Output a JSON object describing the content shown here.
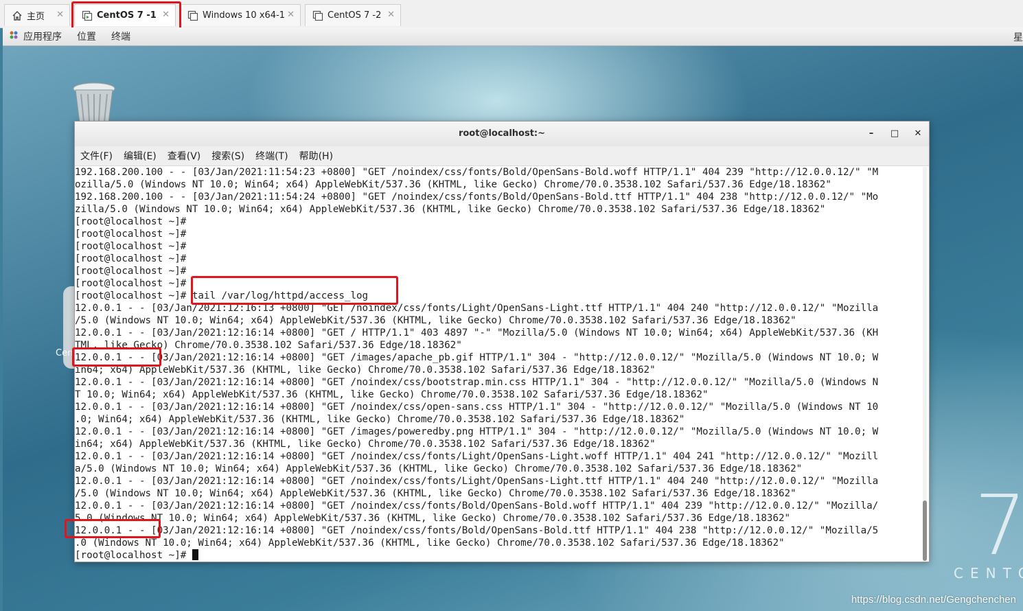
{
  "tabs": [
    {
      "label": "主页",
      "icon": "home-icon"
    },
    {
      "label": "CentOS 7 -1",
      "icon": "vm-icon",
      "active": true
    },
    {
      "label": "Windows 10 x64-1",
      "icon": "vm-icon"
    },
    {
      "label": "CentOS 7 -2",
      "icon": "vm-icon"
    }
  ],
  "tab_close_glyph": "✕",
  "gnome": {
    "apps": "应用程序",
    "places": "位置",
    "terminal": "终端",
    "right_glyph": "星"
  },
  "desktop": {
    "cen_label": "Cen",
    "centos_seven": "7",
    "centos_word": "CENTO",
    "watermark": "https://blog.csdn.net/Gengchenchen"
  },
  "terminal": {
    "title": "root@localhost:~",
    "min": "–",
    "max": "□",
    "close": "✕",
    "menu": [
      "文件(F)",
      "编辑(E)",
      "查看(V)",
      "搜索(S)",
      "终端(T)",
      "帮助(H)"
    ],
    "lines": [
      "192.168.200.100 - - [03/Jan/2021:11:54:23 +0800] \"GET /noindex/css/fonts/Bold/OpenSans-Bold.woff HTTP/1.1\" 404 239 \"http://12.0.0.12/\" \"M",
      "ozilla/5.0 (Windows NT 10.0; Win64; x64) AppleWebKit/537.36 (KHTML, like Gecko) Chrome/70.0.3538.102 Safari/537.36 Edge/18.18362\"",
      "192.168.200.100 - - [03/Jan/2021:11:54:24 +0800] \"GET /noindex/css/fonts/Bold/OpenSans-Bold.ttf HTTP/1.1\" 404 238 \"http://12.0.0.12/\" \"Mo",
      "zilla/5.0 (Windows NT 10.0; Win64; x64) AppleWebKit/537.36 (KHTML, like Gecko) Chrome/70.0.3538.102 Safari/537.36 Edge/18.18362\"",
      "[root@localhost ~]#",
      "[root@localhost ~]#",
      "[root@localhost ~]#",
      "[root@localhost ~]#",
      "[root@localhost ~]#",
      "[root@localhost ~]#",
      "[root@localhost ~]# tail /var/log/httpd/access_log",
      "12.0.0.1 - - [03/Jan/2021:12:16:13 +0800] \"GET /noindex/css/fonts/Light/OpenSans-Light.ttf HTTP/1.1\" 404 240 \"http://12.0.0.12/\" \"Mozilla",
      "/5.0 (Windows NT 10.0; Win64; x64) AppleWebKit/537.36 (KHTML, like Gecko) Chrome/70.0.3538.102 Safari/537.36 Edge/18.18362\"",
      "12.0.0.1 - - [03/Jan/2021:12:16:14 +0800] \"GET / HTTP/1.1\" 403 4897 \"-\" \"Mozilla/5.0 (Windows NT 10.0; Win64; x64) AppleWebKit/537.36 (KH",
      "TML, like Gecko) Chrome/70.0.3538.102 Safari/537.36 Edge/18.18362\"",
      "12.0.0.1 - - [03/Jan/2021:12:16:14 +0800] \"GET /images/apache_pb.gif HTTP/1.1\" 304 - \"http://12.0.0.12/\" \"Mozilla/5.0 (Windows NT 10.0; W",
      "in64; x64) AppleWebKit/537.36 (KHTML, like Gecko) Chrome/70.0.3538.102 Safari/537.36 Edge/18.18362\"",
      "12.0.0.1 - - [03/Jan/2021:12:16:14 +0800] \"GET /noindex/css/bootstrap.min.css HTTP/1.1\" 304 - \"http://12.0.0.12/\" \"Mozilla/5.0 (Windows N",
      "T 10.0; Win64; x64) AppleWebKit/537.36 (KHTML, like Gecko) Chrome/70.0.3538.102 Safari/537.36 Edge/18.18362\"",
      "12.0.0.1 - - [03/Jan/2021:12:16:14 +0800] \"GET /noindex/css/open-sans.css HTTP/1.1\" 304 - \"http://12.0.0.12/\" \"Mozilla/5.0 (Windows NT 10",
      ".0; Win64; x64) AppleWebKit/537.36 (KHTML, like Gecko) Chrome/70.0.3538.102 Safari/537.36 Edge/18.18362\"",
      "12.0.0.1 - - [03/Jan/2021:12:16:14 +0800] \"GET /images/poweredby.png HTTP/1.1\" 304 - \"http://12.0.0.12/\" \"Mozilla/5.0 (Windows NT 10.0; W",
      "in64; x64) AppleWebKit/537.36 (KHTML, like Gecko) Chrome/70.0.3538.102 Safari/537.36 Edge/18.18362\"",
      "12.0.0.1 - - [03/Jan/2021:12:16:14 +0800] \"GET /noindex/css/fonts/Light/OpenSans-Light.woff HTTP/1.1\" 404 241 \"http://12.0.0.12/\" \"Mozill",
      "a/5.0 (Windows NT 10.0; Win64; x64) AppleWebKit/537.36 (KHTML, like Gecko) Chrome/70.0.3538.102 Safari/537.36 Edge/18.18362\"",
      "12.0.0.1 - - [03/Jan/2021:12:16:14 +0800] \"GET /noindex/css/fonts/Light/OpenSans-Light.ttf HTTP/1.1\" 404 240 \"http://12.0.0.12/\" \"Mozilla",
      "/5.0 (Windows NT 10.0; Win64; x64) AppleWebKit/537.36 (KHTML, like Gecko) Chrome/70.0.3538.102 Safari/537.36 Edge/18.18362\"",
      "12.0.0.1 - - [03/Jan/2021:12:16:14 +0800] \"GET /noindex/css/fonts/Bold/OpenSans-Bold.woff HTTP/1.1\" 404 239 \"http://12.0.0.12/\" \"Mozilla/",
      "5.0 (Windows NT 10.0; Win64; x64) AppleWebKit/537.36 (KHTML, like Gecko) Chrome/70.0.3538.102 Safari/537.36 Edge/18.18362\"",
      "12.0.0.1 - - [03/Jan/2021:12:16:14 +0800] \"GET /noindex/css/fonts/Bold/OpenSans-Bold.ttf HTTP/1.1\" 404 238 \"http://12.0.0.12/\" \"Mozilla/5",
      ".0 (Windows NT 10.0; Win64; x64) AppleWebKit/537.36 (KHTML, like Gecko) Chrome/70.0.3538.102 Safari/537.36 Edge/18.18362\"",
      "[root@localhost ~]# "
    ]
  },
  "colors": {
    "highlight": "#e3141b",
    "terminal_bg": "#ffffff",
    "terminal_text": "#222222"
  }
}
